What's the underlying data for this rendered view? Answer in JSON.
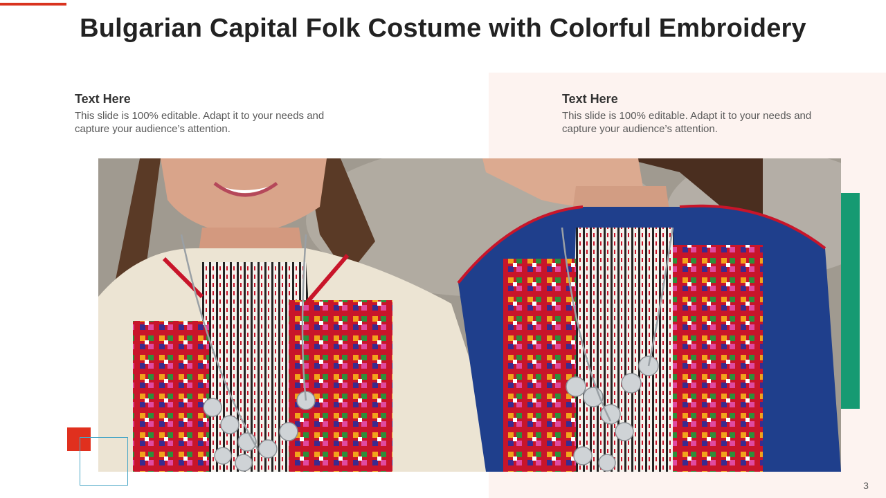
{
  "slide": {
    "title": "Bulgarian Capital Folk Costume with Colorful Embroidery",
    "page_number": "3"
  },
  "blocks": [
    {
      "heading": "Text Here",
      "body": "This slide is 100% editable. Adapt it to your needs and capture your audience’s attention."
    },
    {
      "heading": "Text Here",
      "body": "This slide is 100% editable. Adapt it to your needs and capture your audience’s attention."
    }
  ],
  "photo": {
    "subject": "two-women-bulgarian-folk-costume"
  },
  "colors": {
    "accent_red": "#d9331f",
    "accent_green": "#169a72",
    "accent_blue_outline": "#49a6c6",
    "panel_tint": "#fdf3f0",
    "title_text": "#222222",
    "body_text": "#595959"
  }
}
